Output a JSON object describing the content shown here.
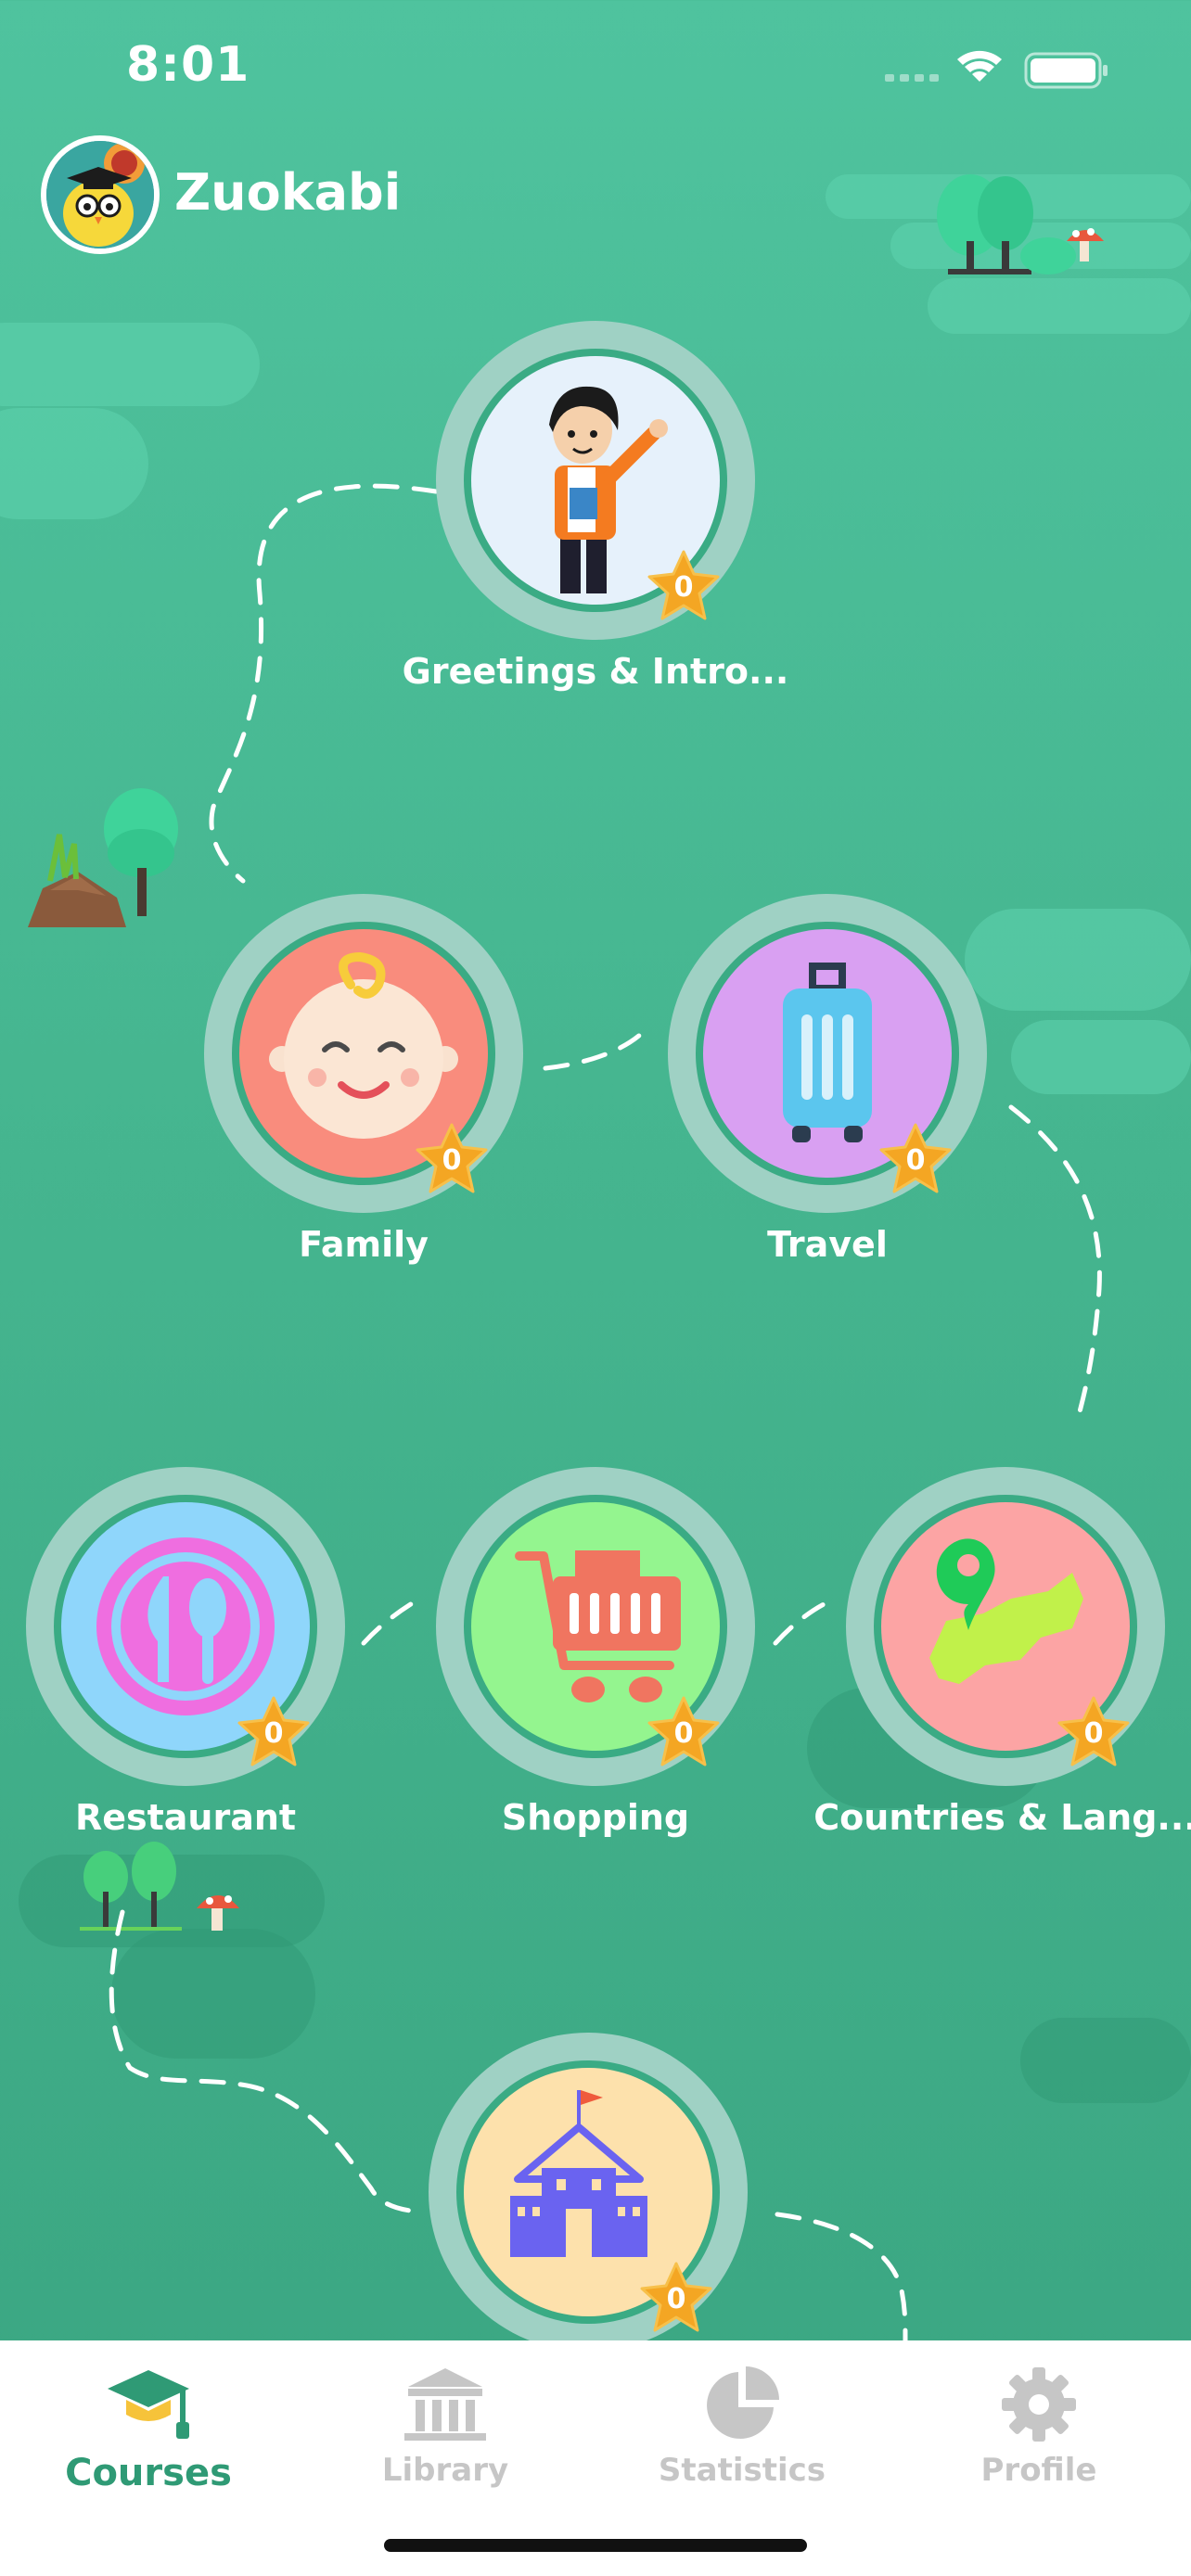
{
  "status_bar": {
    "time": "8:01"
  },
  "header": {
    "username": "Zuokabi"
  },
  "courses": [
    {
      "title": "Greetings & Intro...",
      "stars": "0"
    },
    {
      "title": "Family",
      "stars": "0"
    },
    {
      "title": "Travel",
      "stars": "0"
    },
    {
      "title": "Restaurant",
      "stars": "0"
    },
    {
      "title": "Shopping",
      "stars": "0"
    },
    {
      "title": "Countries & Lang...",
      "stars": "0"
    },
    {
      "title": "",
      "stars": "0"
    }
  ],
  "tabbar": {
    "items": [
      {
        "label": "Courses",
        "icon": "graduation-cap-icon",
        "active": true
      },
      {
        "label": "Library",
        "icon": "library-icon",
        "active": false
      },
      {
        "label": "Statistics",
        "icon": "pie-chart-icon",
        "active": false
      },
      {
        "label": "Profile",
        "icon": "gear-icon",
        "active": false
      }
    ]
  },
  "colors": {
    "accent": "#2f9a75",
    "star": "#f4a623",
    "background": "#45b58f"
  }
}
